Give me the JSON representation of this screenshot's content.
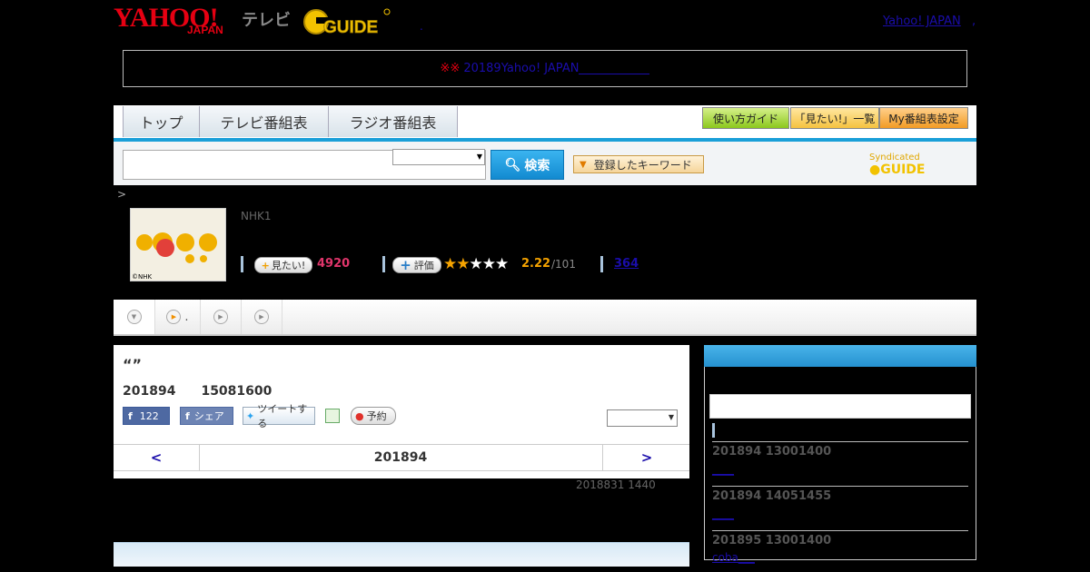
{
  "header": {
    "logo_yahoo": "YAHOO!",
    "logo_japan": "JAPAN",
    "logo_tv": "テレビ",
    "logo_gguide": "G GUIDE",
    "home_link": "Yahoo! JAPAN",
    "dot": ",",
    "mid_dot": "."
  },
  "notice": {
    "mark": "※※",
    "link": "20189Yahoo! JAPAN"
  },
  "nav": {
    "tabs": [
      "トップ",
      "テレビ番組表",
      "ラジオ番組表"
    ],
    "right_buttons": [
      "使い方ガイド",
      "「見たい!」一覧",
      "My番組表設定"
    ]
  },
  "search": {
    "button": "検索",
    "keyword_button": "登録したキーワード",
    "syndicated": "Syndicated"
  },
  "breadcrumb": ">",
  "program": {
    "thumb_credit": "©NHK",
    "channel": "NHK1",
    "want_button": "見たい!",
    "want_count": "4920",
    "rate_button": "評価",
    "rating_stars": 2.22,
    "rating": "2.22",
    "rating_total": "/101",
    "reviews": "364"
  },
  "tabstrip": {
    "item2_label": "."
  },
  "main": {
    "quote": "“”",
    "date_line": "201894　　15081600",
    "fb_like_count": "122",
    "fb_share": "シェア",
    "tweet": "ツイートする",
    "reserve": "予約",
    "pager_prev": "<",
    "pager_date": "201894",
    "pager_next": ">",
    "updated": "2018831  1440"
  },
  "sidebar": {
    "entries": [
      {
        "date": "201894  13001400",
        "link": "____"
      },
      {
        "date": "201894  14051455",
        "link": "____"
      },
      {
        "date": "201895  13001400",
        "link": "coba___"
      }
    ]
  },
  "colors": {
    "yahoo_red": "#e60012",
    "nav_blue": "#1a9fd8",
    "star_orange": "#f5a300",
    "want_pink": "#e0356b"
  }
}
